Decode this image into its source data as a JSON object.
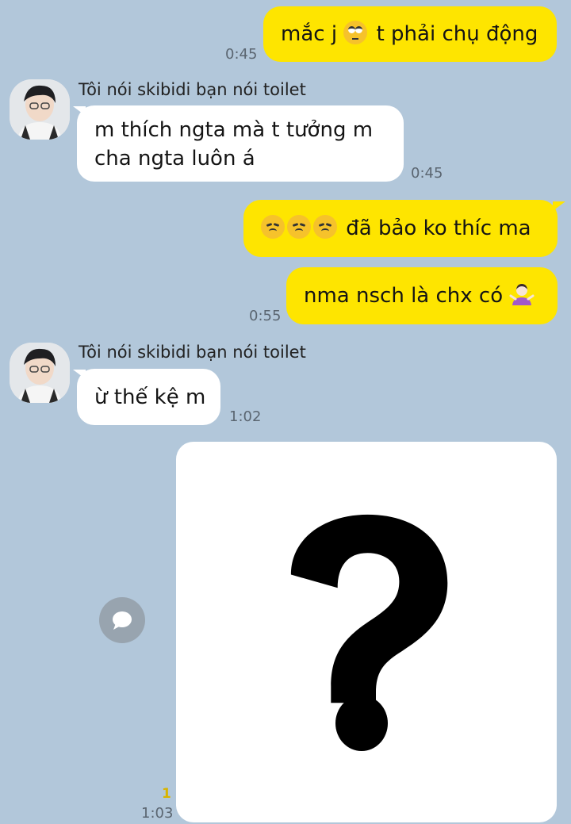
{
  "messages": [
    {
      "id": "m1",
      "side": "out",
      "text_before": "mắc j",
      "emoji": "face-with-rolling-eyes",
      "text_after": " t phải chụ động",
      "time": "0:45"
    },
    {
      "id": "m2",
      "side": "in",
      "sender": "Tôi nói skibidi bạn nói toilet",
      "lines": [
        "m thích ngta mà t tưởng m",
        "cha ngta luôn á"
      ],
      "time": "0:45"
    },
    {
      "id": "m3",
      "side": "out",
      "emoji": "disappointed-face x3",
      "text": " đã bảo ko thíc ma"
    },
    {
      "id": "m4",
      "side": "out",
      "text": "nma nsch là chx có ",
      "emoji": "person-shrugging",
      "time": "0:55"
    },
    {
      "id": "m5",
      "side": "in",
      "sender": "Tôi nói skibidi bạn nói toilet",
      "text": "ừ thế kệ m",
      "time": "1:02"
    },
    {
      "id": "m6",
      "side": "out",
      "type": "image",
      "image_symbol": "question-mark",
      "unread_count": "1",
      "time": "1:03"
    }
  ],
  "colors": {
    "background": "#b2c7da",
    "outgoing_bubble": "#fee500",
    "incoming_bubble": "#ffffff",
    "unread_count": "#d8b400"
  }
}
